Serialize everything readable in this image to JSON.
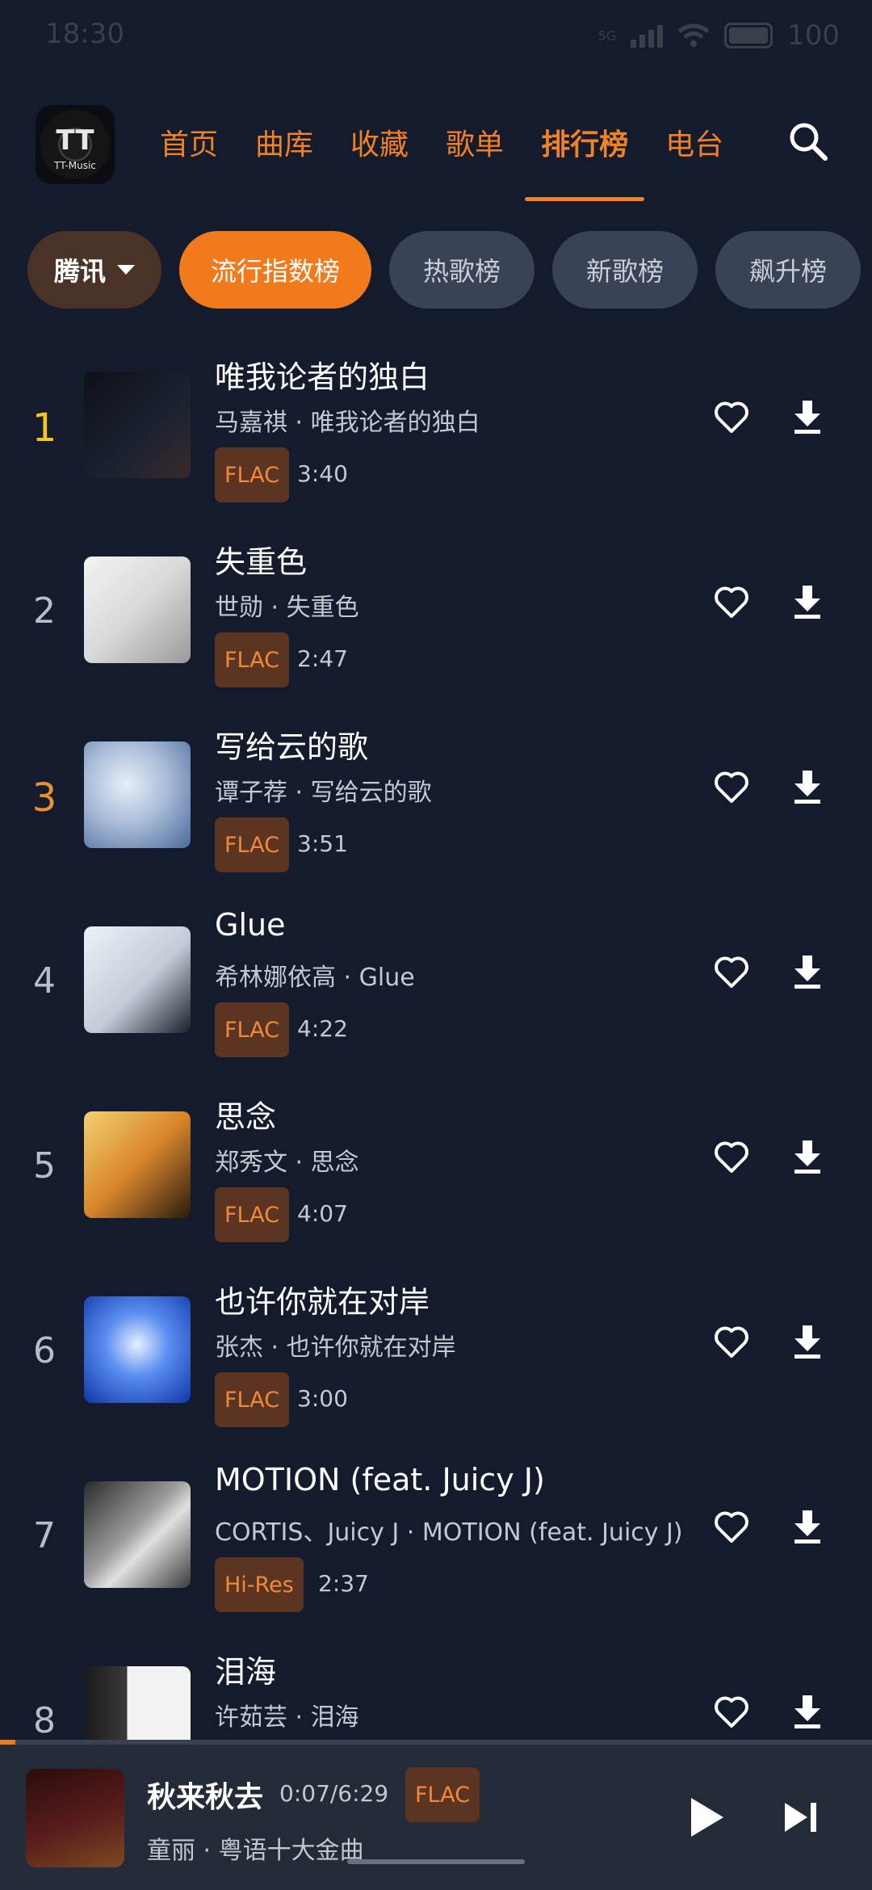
{
  "status": {
    "time": "18:30",
    "battery": "100",
    "net": "5G"
  },
  "header": {
    "logo": {
      "main": "TT",
      "sub": "TT-Music"
    },
    "tabs": [
      {
        "label": "首页",
        "active": false
      },
      {
        "label": "曲库",
        "active": false
      },
      {
        "label": "收藏",
        "active": false
      },
      {
        "label": "歌单",
        "active": false
      },
      {
        "label": "排行榜",
        "active": true
      },
      {
        "label": "电台",
        "active": false
      }
    ],
    "search_icon": "search-icon"
  },
  "chips": {
    "source": "腾讯",
    "items": [
      {
        "label": "流行指数榜",
        "active": true
      },
      {
        "label": "热歌榜",
        "active": false
      },
      {
        "label": "新歌榜",
        "active": false
      },
      {
        "label": "飙升榜",
        "active": false
      }
    ]
  },
  "songs": [
    {
      "rank": "1",
      "title": "唯我论者的独白",
      "artist": "马嘉祺 · 唯我论者的独白",
      "quality": "FLAC",
      "duration": "3:40",
      "cover": "#2a2f3a"
    },
    {
      "rank": "2",
      "title": "失重色",
      "artist": "世勋 · 失重色",
      "quality": "FLAC",
      "duration": "2:47",
      "cover": "#e8e8e8"
    },
    {
      "rank": "3",
      "title": "写给云的歌",
      "artist": "谭子荐 · 写给云的歌",
      "quality": "FLAC",
      "duration": "3:51",
      "cover": "#8aa4c8"
    },
    {
      "rank": "4",
      "title": "Glue",
      "artist": "希林娜依高 · Glue",
      "quality": "FLAC",
      "duration": "4:22",
      "cover": "#c9d2de"
    },
    {
      "rank": "5",
      "title": "思念",
      "artist": "郑秀文 · 思念",
      "quality": "FLAC",
      "duration": "4:07",
      "cover": "#d88a2a"
    },
    {
      "rank": "6",
      "title": "也许你就在对岸",
      "artist": "张杰 · 也许你就在对岸",
      "quality": "FLAC",
      "duration": "3:00",
      "cover": "#2a62d8"
    },
    {
      "rank": "7",
      "title": "MOTION (feat. Juicy J)",
      "artist": "CORTIS、Juicy J · MOTION (feat. Juicy J)",
      "quality": "Hi-Res",
      "duration": "2:37",
      "cover": "#8a8a8a"
    },
    {
      "rank": "8",
      "title": "泪海",
      "artist": "许茹芸 · 泪海",
      "quality": "",
      "duration": "",
      "cover": "#f2f2f2"
    }
  ],
  "player": {
    "title": "秋来秋去",
    "time": "0:07/6:29",
    "quality": "FLAC",
    "artist": "童丽 · 粤语十大金曲",
    "progress": 0.018
  },
  "colors": {
    "accent": "#f07a1c",
    "background": "#141b2c",
    "badge_bg": "#5b3422",
    "rank_gold": "#f5c518",
    "rank_bronze": "#e98f34"
  }
}
